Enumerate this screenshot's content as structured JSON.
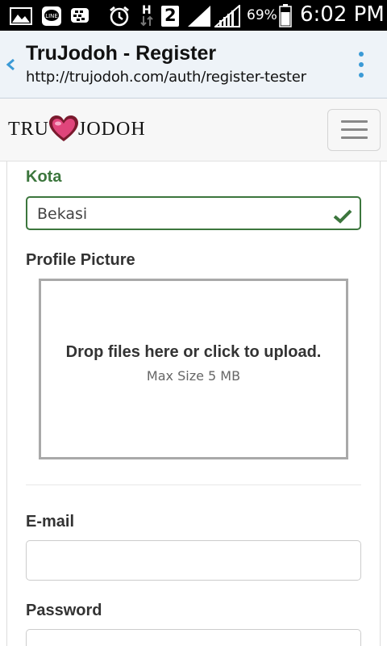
{
  "status_bar": {
    "battery": "69%",
    "time": "6:02 PM",
    "sim_badge": "2",
    "network_badge": "H",
    "icons": [
      "image-icon",
      "line-app-icon",
      "bbm-icon",
      "alarm-icon",
      "hspa-data-icon",
      "sim2-icon",
      "signal-icon",
      "signal-icon",
      "battery-icon"
    ]
  },
  "browser": {
    "title": "TruJodoh - Register",
    "url": "http://trujodoh.com/auth/register-tester",
    "accent": "#3b9ad6"
  },
  "site": {
    "logo_left": "TRU",
    "logo_right": "JODOH"
  },
  "form": {
    "kota": {
      "label": "Kota",
      "value": "Bekasi",
      "status_color": "#3c763d"
    },
    "profile_picture": {
      "label": "Profile Picture",
      "dropzone_title": "Drop files here or click to upload.",
      "dropzone_subtitle": "Max Size 5 MB"
    },
    "email": {
      "label": "E-mail",
      "value": ""
    },
    "password": {
      "label": "Password",
      "value": ""
    }
  }
}
